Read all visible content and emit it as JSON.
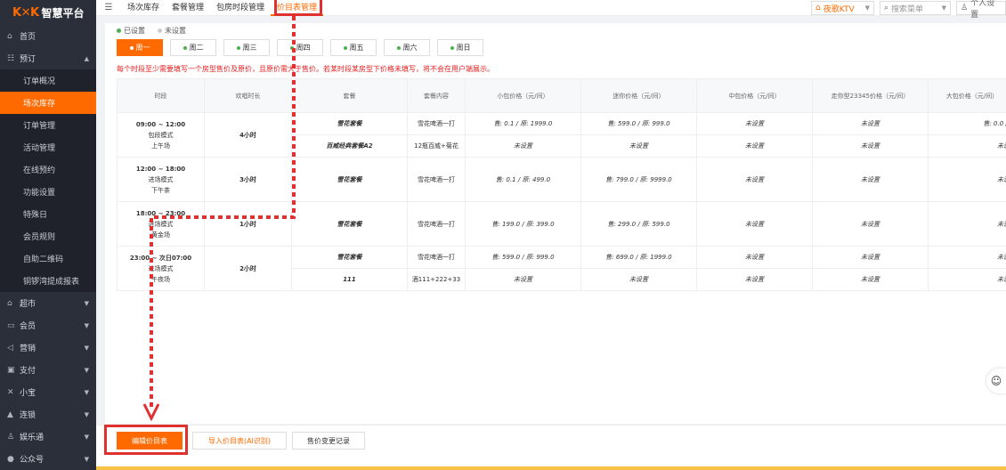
{
  "brand": {
    "mark": "K✕K",
    "name": "智慧平台",
    "accent": "#ff6a00"
  },
  "topbar": {
    "tabs": [
      "场次库存",
      "套餐管理",
      "包房时段管理",
      "价目表管理"
    ],
    "active_tab": 3,
    "store": "夜歌KTV",
    "search_placeholder": "搜索菜单",
    "user": "个人设置"
  },
  "sidebar": {
    "items": [
      {
        "icon": "home-icon",
        "glyph": "⌂",
        "label": "首页"
      },
      {
        "icon": "booking-icon",
        "glyph": "☷",
        "label": "预订",
        "open": true
      }
    ],
    "sub_items": [
      "订单概况",
      "场次库存",
      "订单管理",
      "活动管理",
      "在线预约",
      "功能设置",
      "特殊日",
      "会员规则",
      "自助二维码",
      "铜锣湾提成报表"
    ],
    "active_sub": 1,
    "more_items": [
      {
        "icon": "market-icon",
        "glyph": "⌂",
        "label": "超市"
      },
      {
        "icon": "member-icon",
        "glyph": "▭",
        "label": "会员"
      },
      {
        "icon": "marketing-icon",
        "glyph": "◁",
        "label": "营销"
      },
      {
        "icon": "payment-icon",
        "glyph": "▣",
        "label": "支付"
      },
      {
        "icon": "assistant-icon",
        "glyph": "✕",
        "label": "小宝"
      },
      {
        "icon": "chain-icon",
        "glyph": "▲",
        "label": "连锁"
      },
      {
        "icon": "entertainment-icon",
        "glyph": "♙",
        "label": "娱乐通"
      },
      {
        "icon": "official-account-icon",
        "glyph": "●",
        "label": "公众号"
      }
    ]
  },
  "legend": {
    "set": "已设置",
    "unset": "未设置",
    "set_color": "#4caf50",
    "unset_color": "#cccccc"
  },
  "days": [
    "周一",
    "周二",
    "周三",
    "周四",
    "周五",
    "周六",
    "周日"
  ],
  "active_day": 0,
  "notice": "每个时段至少需要填写一个房型售价及原价，且原价需大于售价。若某时段某房型下价格未填写，将不会在用户端展示。",
  "table": {
    "headers": [
      "时段",
      "欢唱时长",
      "套餐",
      "套餐内容",
      "小包价格（元/间）",
      "迷你价格（元/间）",
      "中包价格（元/间）",
      "走你型23345价格（元/间）",
      "大包价格（元/间）"
    ],
    "unset_text": "未设置",
    "groups": [
      {
        "time": "09:00 ~ 12:00",
        "mode": "包段模式",
        "name": "上午场",
        "duration": "4小时",
        "rows": [
          {
            "pkg": "雪花套餐",
            "content": "雪花啤酒一打",
            "prices": [
              "售: 0.1 / 原: 1999.0",
              "售: 599.0 / 原: 999.0",
              "",
              "",
              "售: 0.0 / 原"
            ]
          },
          {
            "pkg": "百威经典套餐A2",
            "content": "12瓶百威+菊花",
            "prices": [
              "",
              "",
              "",
              "",
              ""
            ]
          }
        ]
      },
      {
        "time": "12:00 ~ 18:00",
        "mode": "进场模式",
        "name": "下午茶",
        "duration": "3小时",
        "rows": [
          {
            "pkg": "雪花套餐",
            "content": "雪花啤酒一打",
            "prices": [
              "售: 0.1 / 原: 499.0",
              "售: 799.0 / 原: 9999.0",
              "",
              "",
              ""
            ]
          }
        ]
      },
      {
        "time": "18:00 ~ 23:00",
        "mode": "进场模式",
        "name": "黄金场",
        "duration": "1小时",
        "rows": [
          {
            "pkg": "雪花套餐",
            "content": "雪花啤酒一打",
            "prices": [
              "售: 199.0 / 原: 399.0",
              "售: 299.0 / 原: 599.0",
              "",
              "",
              ""
            ]
          }
        ]
      },
      {
        "time": "23:00 ~ 次日07:00",
        "mode": "进场模式",
        "name": "午夜场",
        "duration": "2小时",
        "rows": [
          {
            "pkg": "雪花套餐",
            "content": "雪花啤酒一打",
            "prices": [
              "售: 599.0 / 原: 999.0",
              "售: 699.0 / 原: 1999.0",
              "",
              "",
              ""
            ]
          },
          {
            "pkg": "111",
            "content": "酒111+222+33",
            "prices": [
              "",
              "",
              "",
              "",
              ""
            ]
          }
        ]
      }
    ]
  },
  "bottom": {
    "edit": "编辑价目表",
    "import": "导入价目表(AI识别)",
    "history": "售价变更记录"
  },
  "annotation_color": "#e03030"
}
